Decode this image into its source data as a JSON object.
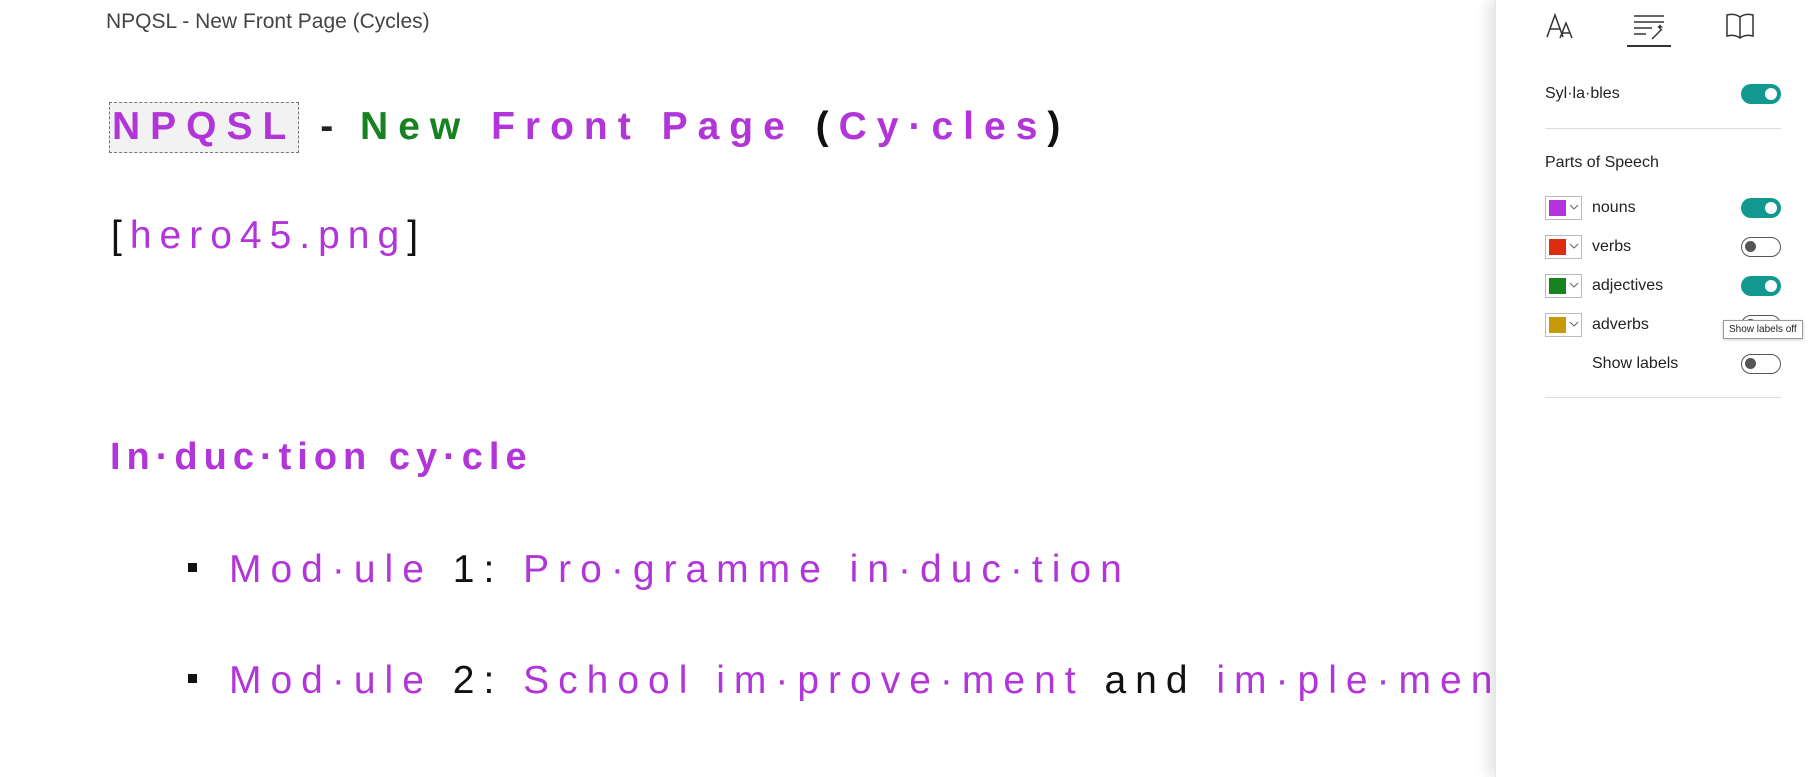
{
  "document": {
    "title": "NPQSL - New Front Page (Cycles)",
    "heading": {
      "word1": "NPQSL",
      "dash": "-",
      "word2": "New",
      "word3": "Front",
      "word4": "Page",
      "open_paren": "(",
      "word5": "Cy·cles",
      "close_paren": ")"
    },
    "image_ref": {
      "open": "[",
      "name": "hero45.png",
      "close": "]"
    },
    "section_heading": "In·duc·tion cy·cle",
    "bullets": [
      {
        "word1": "Mod·ule",
        "number": "1",
        "colon": ":",
        "text1": "Pro·gramme in·duc·tion"
      },
      {
        "word1": "Mod·ule",
        "number": "2",
        "colon": ":",
        "text1": "School im·prove·ment",
        "conj": "and",
        "text2": "im·ple·men·ta"
      }
    ]
  },
  "panel": {
    "tabs": [
      {
        "icon": "text-size-icon",
        "active": false
      },
      {
        "icon": "grammar-options-icon",
        "active": true
      },
      {
        "icon": "reading-preferences-icon",
        "active": false
      }
    ],
    "syllables": {
      "label": "Syl·la·bles",
      "on": true
    },
    "parts_of_speech": {
      "label": "Parts of Speech",
      "items": [
        {
          "label": "nouns",
          "color": "#b135d8",
          "on": true
        },
        {
          "label": "verbs",
          "color": "#dd2c10",
          "on": false
        },
        {
          "label": "adjectives",
          "color": "#17821f",
          "on": true
        },
        {
          "label": "adverbs",
          "color": "#c89a08",
          "on": false
        }
      ],
      "show_labels": {
        "label": "Show labels",
        "on": false
      }
    },
    "tooltip": "Show labels off"
  }
}
